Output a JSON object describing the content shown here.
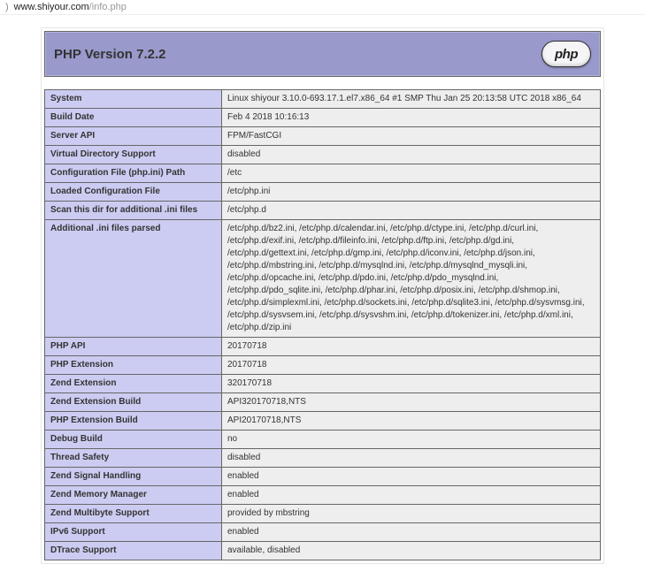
{
  "addressbar": {
    "host": "www.shiyour.com",
    "path": "/info.php"
  },
  "header": {
    "title": "PHP Version 7.2.2",
    "logo_text": "php"
  },
  "rows": [
    {
      "label": "System",
      "value": "Linux shiyour 3.10.0-693.17.1.el7.x86_64 #1 SMP Thu Jan 25 20:13:58 UTC 2018 x86_64"
    },
    {
      "label": "Build Date",
      "value": "Feb 4 2018 10:16:13"
    },
    {
      "label": "Server API",
      "value": "FPM/FastCGI"
    },
    {
      "label": "Virtual Directory Support",
      "value": "disabled"
    },
    {
      "label": "Configuration File (php.ini) Path",
      "value": "/etc"
    },
    {
      "label": "Loaded Configuration File",
      "value": "/etc/php.ini"
    },
    {
      "label": "Scan this dir for additional .ini files",
      "value": "/etc/php.d"
    },
    {
      "label": "Additional .ini files parsed",
      "value": "/etc/php.d/bz2.ini, /etc/php.d/calendar.ini, /etc/php.d/ctype.ini, /etc/php.d/curl.ini, /etc/php.d/exif.ini, /etc/php.d/fileinfo.ini, /etc/php.d/ftp.ini, /etc/php.d/gd.ini, /etc/php.d/gettext.ini, /etc/php.d/gmp.ini, /etc/php.d/iconv.ini, /etc/php.d/json.ini, /etc/php.d/mbstring.ini, /etc/php.d/mysqlnd.ini, /etc/php.d/mysqlnd_mysqli.ini, /etc/php.d/opcache.ini, /etc/php.d/pdo.ini, /etc/php.d/pdo_mysqlnd.ini, /etc/php.d/pdo_sqlite.ini, /etc/php.d/phar.ini, /etc/php.d/posix.ini, /etc/php.d/shmop.ini, /etc/php.d/simplexml.ini, /etc/php.d/sockets.ini, /etc/php.d/sqlite3.ini, /etc/php.d/sysvmsg.ini, /etc/php.d/sysvsem.ini, /etc/php.d/sysvshm.ini, /etc/php.d/tokenizer.ini, /etc/php.d/xml.ini, /etc/php.d/zip.ini"
    },
    {
      "label": "PHP API",
      "value": "20170718"
    },
    {
      "label": "PHP Extension",
      "value": "20170718"
    },
    {
      "label": "Zend Extension",
      "value": "320170718"
    },
    {
      "label": "Zend Extension Build",
      "value": "API320170718,NTS"
    },
    {
      "label": "PHP Extension Build",
      "value": "API20170718,NTS"
    },
    {
      "label": "Debug Build",
      "value": "no"
    },
    {
      "label": "Thread Safety",
      "value": "disabled"
    },
    {
      "label": "Zend Signal Handling",
      "value": "enabled"
    },
    {
      "label": "Zend Memory Manager",
      "value": "enabled"
    },
    {
      "label": "Zend Multibyte Support",
      "value": "provided by mbstring"
    },
    {
      "label": "IPv6 Support",
      "value": "enabled"
    },
    {
      "label": "DTrace Support",
      "value": "available, disabled"
    }
  ]
}
